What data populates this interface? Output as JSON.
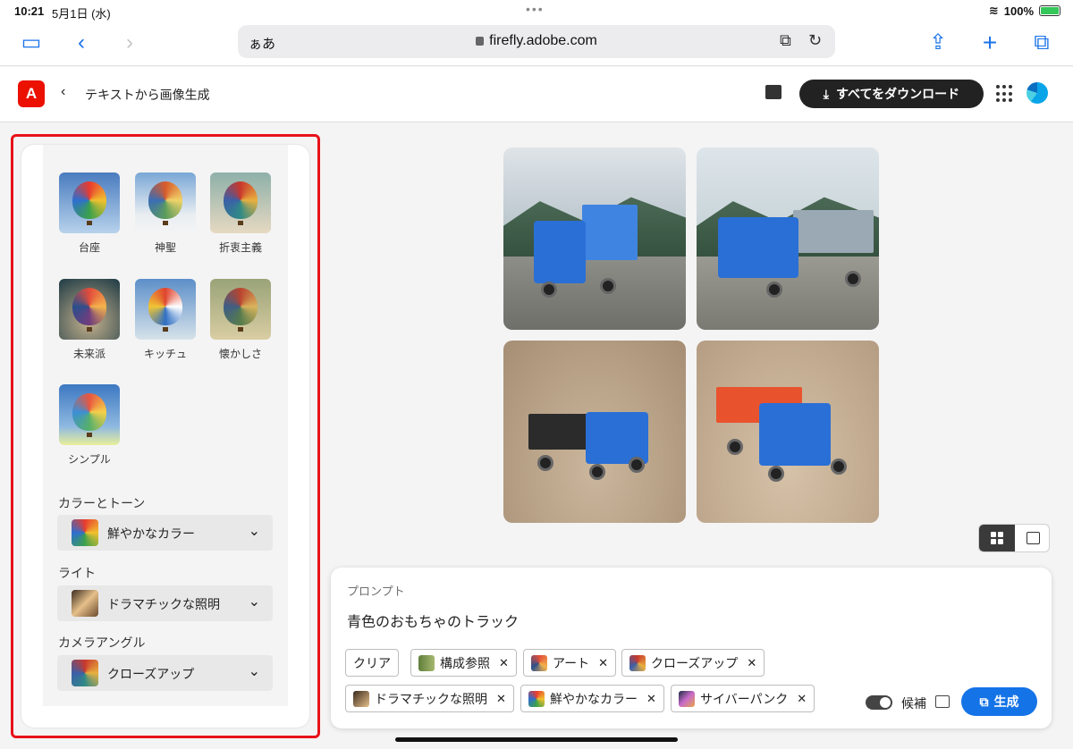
{
  "status_bar": {
    "time": "10:21",
    "date": "5月1日 (水)",
    "battery": "100%"
  },
  "browser": {
    "reader_label": "ぁあ",
    "url": "firefly.adobe.com",
    "icons": [
      "sidebar-icon",
      "back-arrow-icon",
      "forward-arrow-icon",
      "extension-icon",
      "reload-icon",
      "share-icon",
      "new-tab-icon",
      "tabs-icon"
    ]
  },
  "app": {
    "logo_text": "A",
    "title": "テキストから画像生成",
    "download_all_label": "すべてをダウンロード"
  },
  "styles": {
    "items": [
      {
        "label": "台座"
      },
      {
        "label": "神聖"
      },
      {
        "label": "折衷主義"
      },
      {
        "label": "未来派"
      },
      {
        "label": "キッチュ"
      },
      {
        "label": "懐かしさ"
      },
      {
        "label": "シンプル"
      }
    ]
  },
  "settings": {
    "color_tone": {
      "label": "カラーとトーン",
      "value": "鮮やかなカラー"
    },
    "light": {
      "label": "ライト",
      "value": "ドラマチックな照明"
    },
    "camera_angle": {
      "label": "カメラアングル",
      "value": "クローズアップ"
    }
  },
  "prompt": {
    "label": "プロンプト",
    "text": "青色のおもちゃのトラック",
    "clear_label": "クリア",
    "chips": [
      "構成参照",
      "アート",
      "クローズアップ",
      "ドラマチックな照明",
      "鮮やかなカラー",
      "サイバーパンク"
    ],
    "suggest_label": "候補",
    "generate_label": "生成"
  },
  "colors": {
    "accent": "#1473e6",
    "highlight_frame": "#e8121a",
    "adobe_red": "#eb1000"
  }
}
